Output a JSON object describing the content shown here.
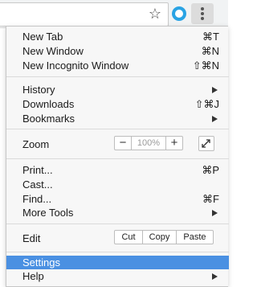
{
  "browser": {
    "star_glyph": "☆",
    "extension_icon": "o-ring-icon",
    "menu_icon": "three-dot-menu-icon"
  },
  "menu": {
    "new_tab": {
      "label": "New Tab",
      "shortcut": "⌘T"
    },
    "new_window": {
      "label": "New Window",
      "shortcut": "⌘N"
    },
    "new_incognito": {
      "label": "New Incognito Window",
      "shortcut": "⇧⌘N"
    },
    "history": {
      "label": "History"
    },
    "downloads": {
      "label": "Downloads",
      "shortcut": "⇧⌘J"
    },
    "bookmarks": {
      "label": "Bookmarks"
    },
    "zoom": {
      "label": "Zoom",
      "minus": "−",
      "value": "100%",
      "plus": "+"
    },
    "print": {
      "label": "Print...",
      "shortcut": "⌘P"
    },
    "cast": {
      "label": "Cast..."
    },
    "find": {
      "label": "Find...",
      "shortcut": "⌘F"
    },
    "more_tools": {
      "label": "More Tools"
    },
    "edit": {
      "label": "Edit",
      "cut": "Cut",
      "copy": "Copy",
      "paste": "Paste"
    },
    "settings": {
      "label": "Settings"
    },
    "help": {
      "label": "Help"
    }
  },
  "colors": {
    "selection": "#4a90e2",
    "menu_background": "#f7f7f7"
  }
}
